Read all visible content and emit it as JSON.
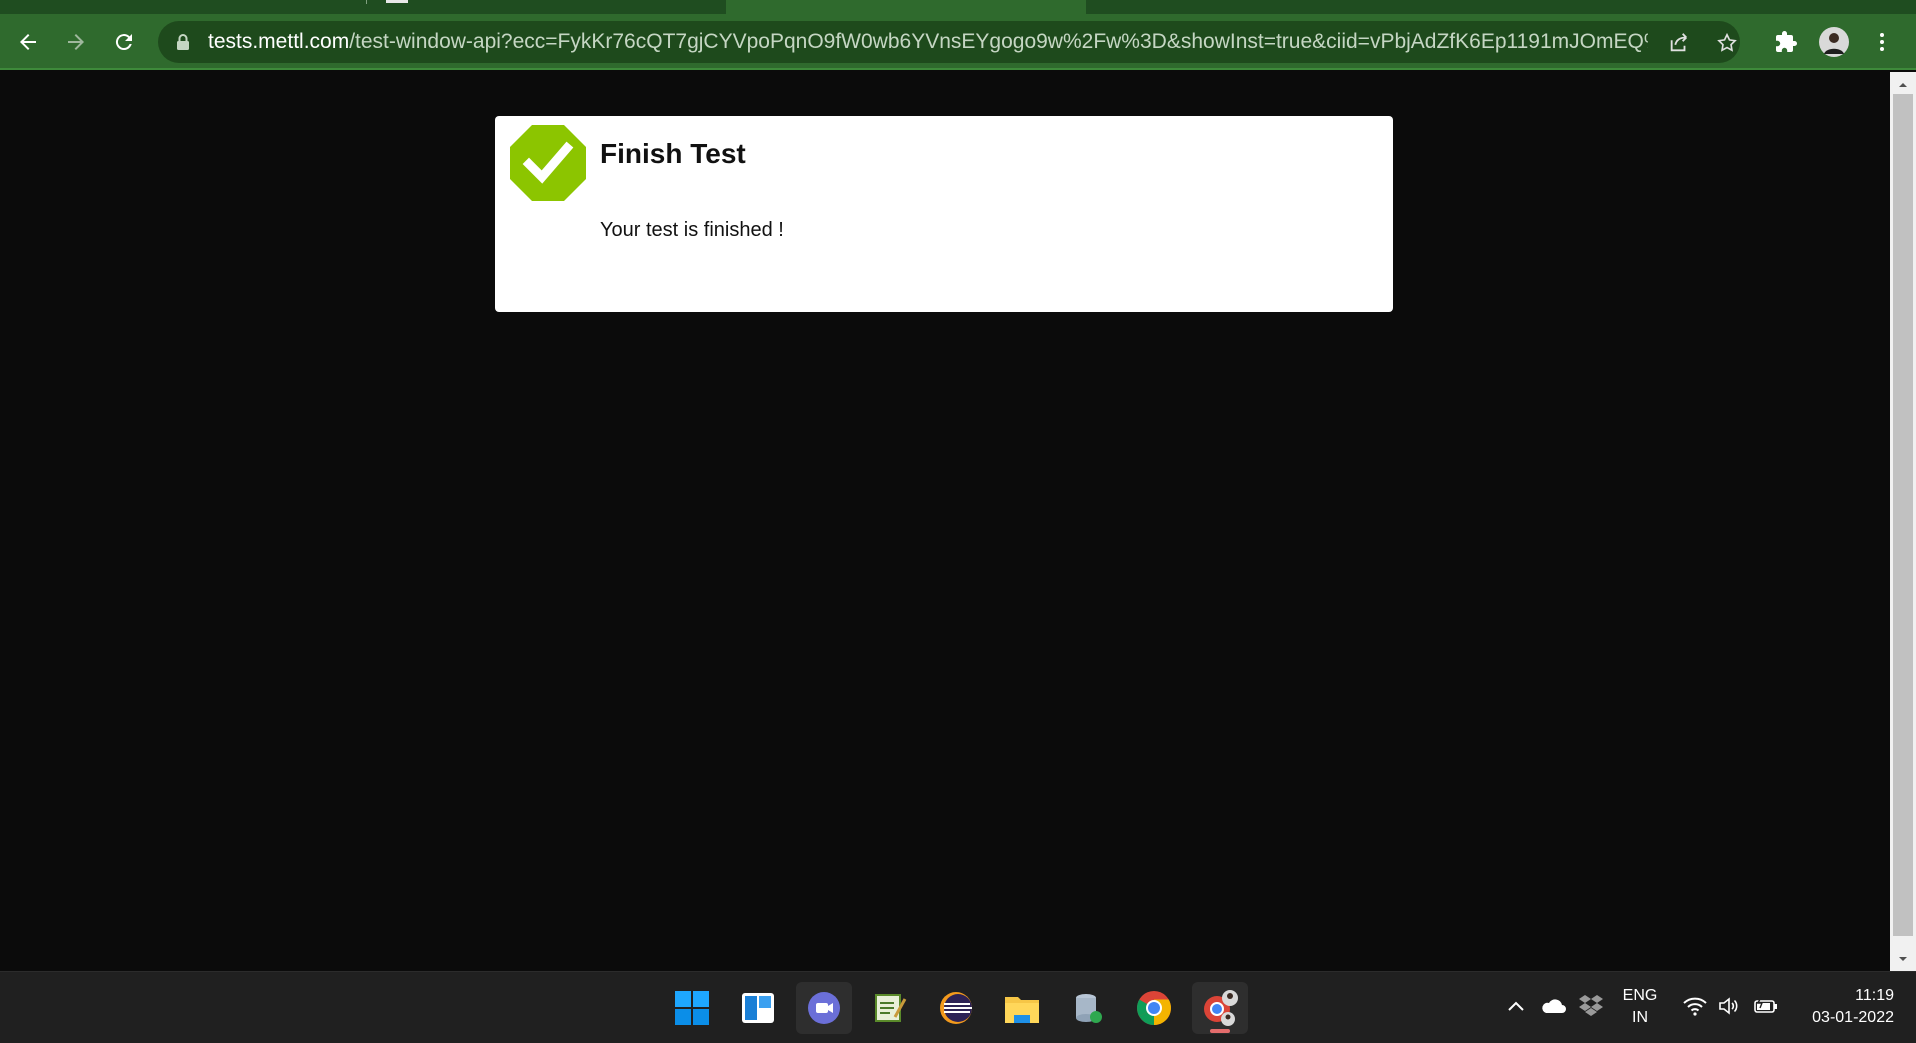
{
  "browser": {
    "url_host": "tests.mettl.com",
    "url_path": "/test-window-api?ecc=FykKr76cQT7gjCYVpoPqnO9fW0wb6YVnsEYgogo9w%2Fw%3D&showInst=true&ciid=vPbjAdZfK6Ep1191mJOmEQ%...",
    "icons": [
      "back-icon",
      "forward-icon",
      "reload-icon",
      "lock-icon",
      "share-icon",
      "star-icon",
      "extensions-icon",
      "profile-avatar",
      "menu-icon"
    ]
  },
  "dialog": {
    "title": "Finish Test",
    "message": "Your test is finished !"
  },
  "taskbar": {
    "apps": [
      "windows-start",
      "task-view",
      "teams-chat",
      "notepad-app",
      "eclipse-app",
      "file-explorer",
      "database-app",
      "chrome-app",
      "chrome-profile-app"
    ],
    "language_line1": "ENG",
    "language_line2": "IN",
    "time": "11:19",
    "date": "03-01-2022"
  },
  "colors": {
    "chrome_green": "#2f6a2d",
    "check_green": "#8cc500",
    "page_bg": "#0b0b0b"
  }
}
